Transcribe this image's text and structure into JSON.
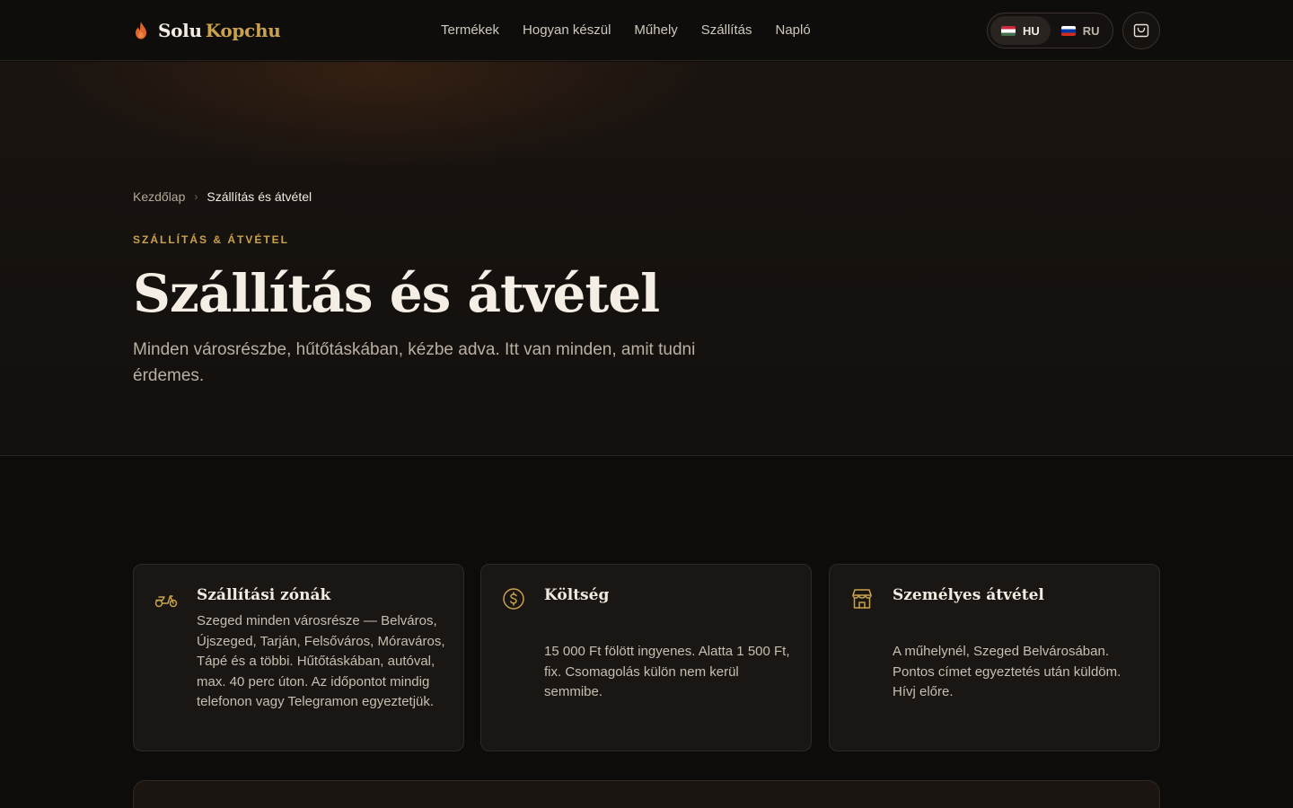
{
  "brand": {
    "name_part1": "Solu",
    "name_part2": "Kopchu"
  },
  "nav": {
    "items": [
      {
        "label": "Termékek"
      },
      {
        "label": "Hogyan készül"
      },
      {
        "label": "Műhely"
      },
      {
        "label": "Szállítás"
      },
      {
        "label": "Napló"
      }
    ]
  },
  "language": {
    "selected": "HU",
    "options": [
      {
        "code": "HU",
        "flag": "hungary-flag-icon"
      },
      {
        "code": "RU",
        "flag": "russia-flag-icon"
      }
    ]
  },
  "cart": {
    "icon": "cart-icon"
  },
  "breadcrumb": {
    "home": "Kezdőlap",
    "separator": "›",
    "current": "Szállítás és átvétel"
  },
  "hero": {
    "eyebrow": "SZÁLLÍTÁS & ÁTVÉTEL",
    "title": "Szállítás és átvétel",
    "subtitle": "Minden városrészbe, hűtőtáskában, kézbe adva. Itt van minden, amit tudni érdemes."
  },
  "cards": [
    {
      "icon": "scooter-icon",
      "title": "Szállítási zónák",
      "body": "Szeged minden városrésze — Belváros, Újszeged, Tarján, Felsőváros, Móraváros, Tápé és a többi. Hűtőtáskában, autóval, max. 40 perc úton. Az időpontot mindig telefonon vagy Telegramon egyeztetjük."
    },
    {
      "icon": "coin-icon",
      "title": "Költség",
      "body": "15 000 Ft fölött ingyenes. Alatta 1 500 Ft, fix. Csomagolás külön nem kerül semmibe."
    },
    {
      "icon": "store-icon",
      "title": "Személyes átvétel",
      "body": "A műhelynél, Szeged Belvárosában. Pontos címet egyeztetés után küldöm. Hívj előre."
    }
  ],
  "colors": {
    "accent_gold": "#c9a24f",
    "flame_orange": "#e0652a",
    "background": "#0e0c0b",
    "card_background": "#1a1613"
  }
}
